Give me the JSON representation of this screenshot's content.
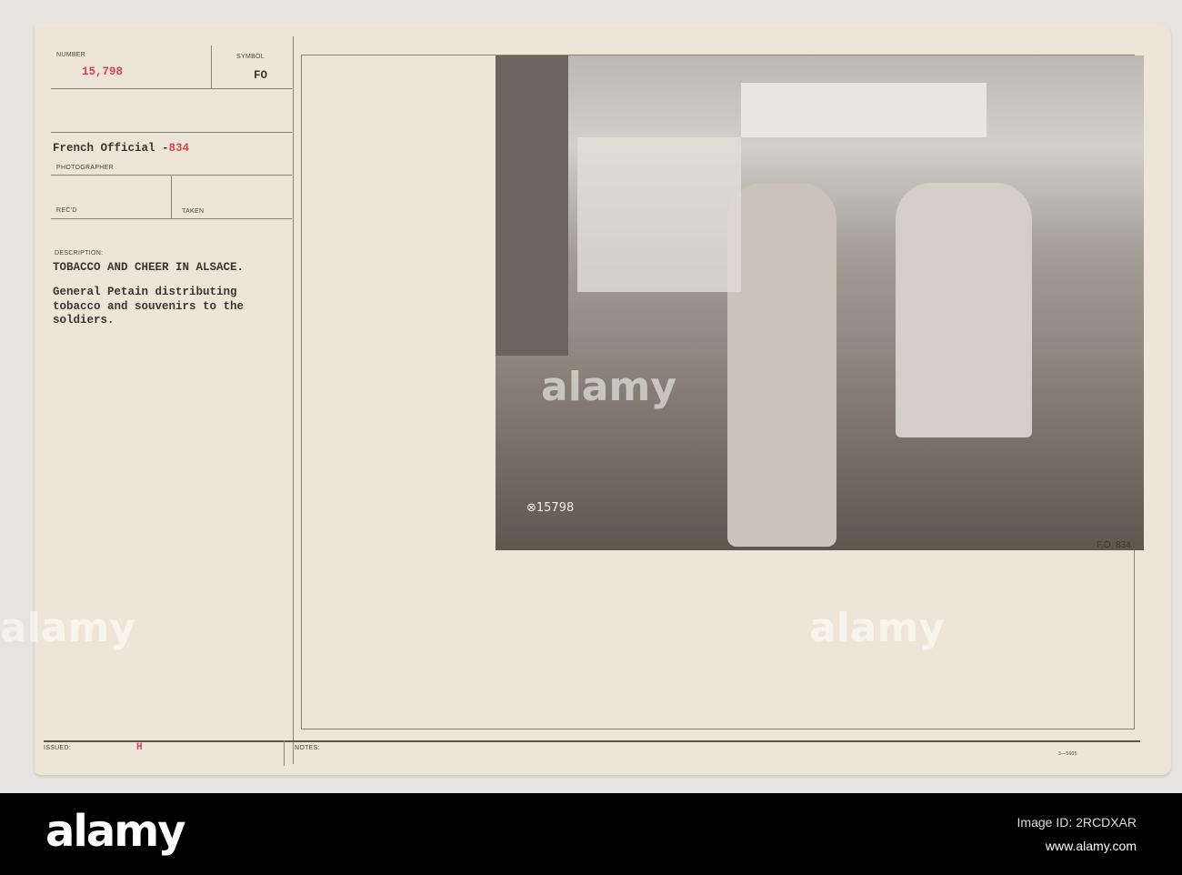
{
  "card": {
    "number_label": "NUMBER",
    "number_value": "15,798",
    "symbol_label": "SYMBOL",
    "symbol_value": "FO",
    "photographer_value_prefix": "French Official -",
    "photographer_value_suffix": "834",
    "photographer_label": "PHOTOGRAPHER",
    "recd_label": "REC'D",
    "taken_label": "TAKEN",
    "description_label": "DESCRIPTION:",
    "description_title": "TOBACCO AND CHEER IN ALSACE.",
    "description_lines": [
      "General Petain distributing",
      "tobacco and souvenirs to the",
      "soldiers."
    ],
    "issued_label": "ISSUED:",
    "issued_value": "H",
    "notes_label": "NOTES:",
    "form_number": "3—5605"
  },
  "photo": {
    "negative_number": "⊗15798",
    "corner_mark": "F.O. 834"
  },
  "watermark": {
    "text": "alamy",
    "image_id": "Image ID: 2RCDXAR",
    "url": "www.alamy.com"
  }
}
